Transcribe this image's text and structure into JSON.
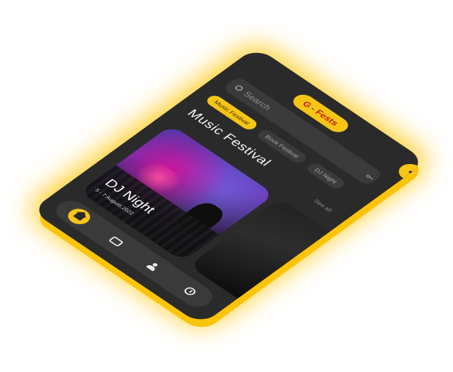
{
  "brand": {
    "name": "G - Fests",
    "notif_icon": "bell-icon"
  },
  "search": {
    "placeholder": "Search",
    "icon": "search-icon",
    "filter_icon": "filter-icon"
  },
  "categories": [
    {
      "label": "Music Festival",
      "active": true
    },
    {
      "label": "Book Festival",
      "active": false
    },
    {
      "label": "DJ Night",
      "active": false
    }
  ],
  "section": {
    "title": "Music Festival",
    "see_all": "See all"
  },
  "events": [
    {
      "title": "DJ Night",
      "date": "5 - 7 August,2022"
    },
    {
      "title": "",
      "date": ""
    }
  ],
  "nav": [
    {
      "icon": "home-icon",
      "active": true
    },
    {
      "icon": "ticket-icon",
      "active": false
    },
    {
      "icon": "profile-icon",
      "active": false
    },
    {
      "icon": "history-icon",
      "active": false
    }
  ],
  "colors": {
    "accent": "#f6c516",
    "brand_text": "#c21a1a",
    "surface": "#2a2a2a",
    "surface_alt": "#3a3a3a"
  }
}
